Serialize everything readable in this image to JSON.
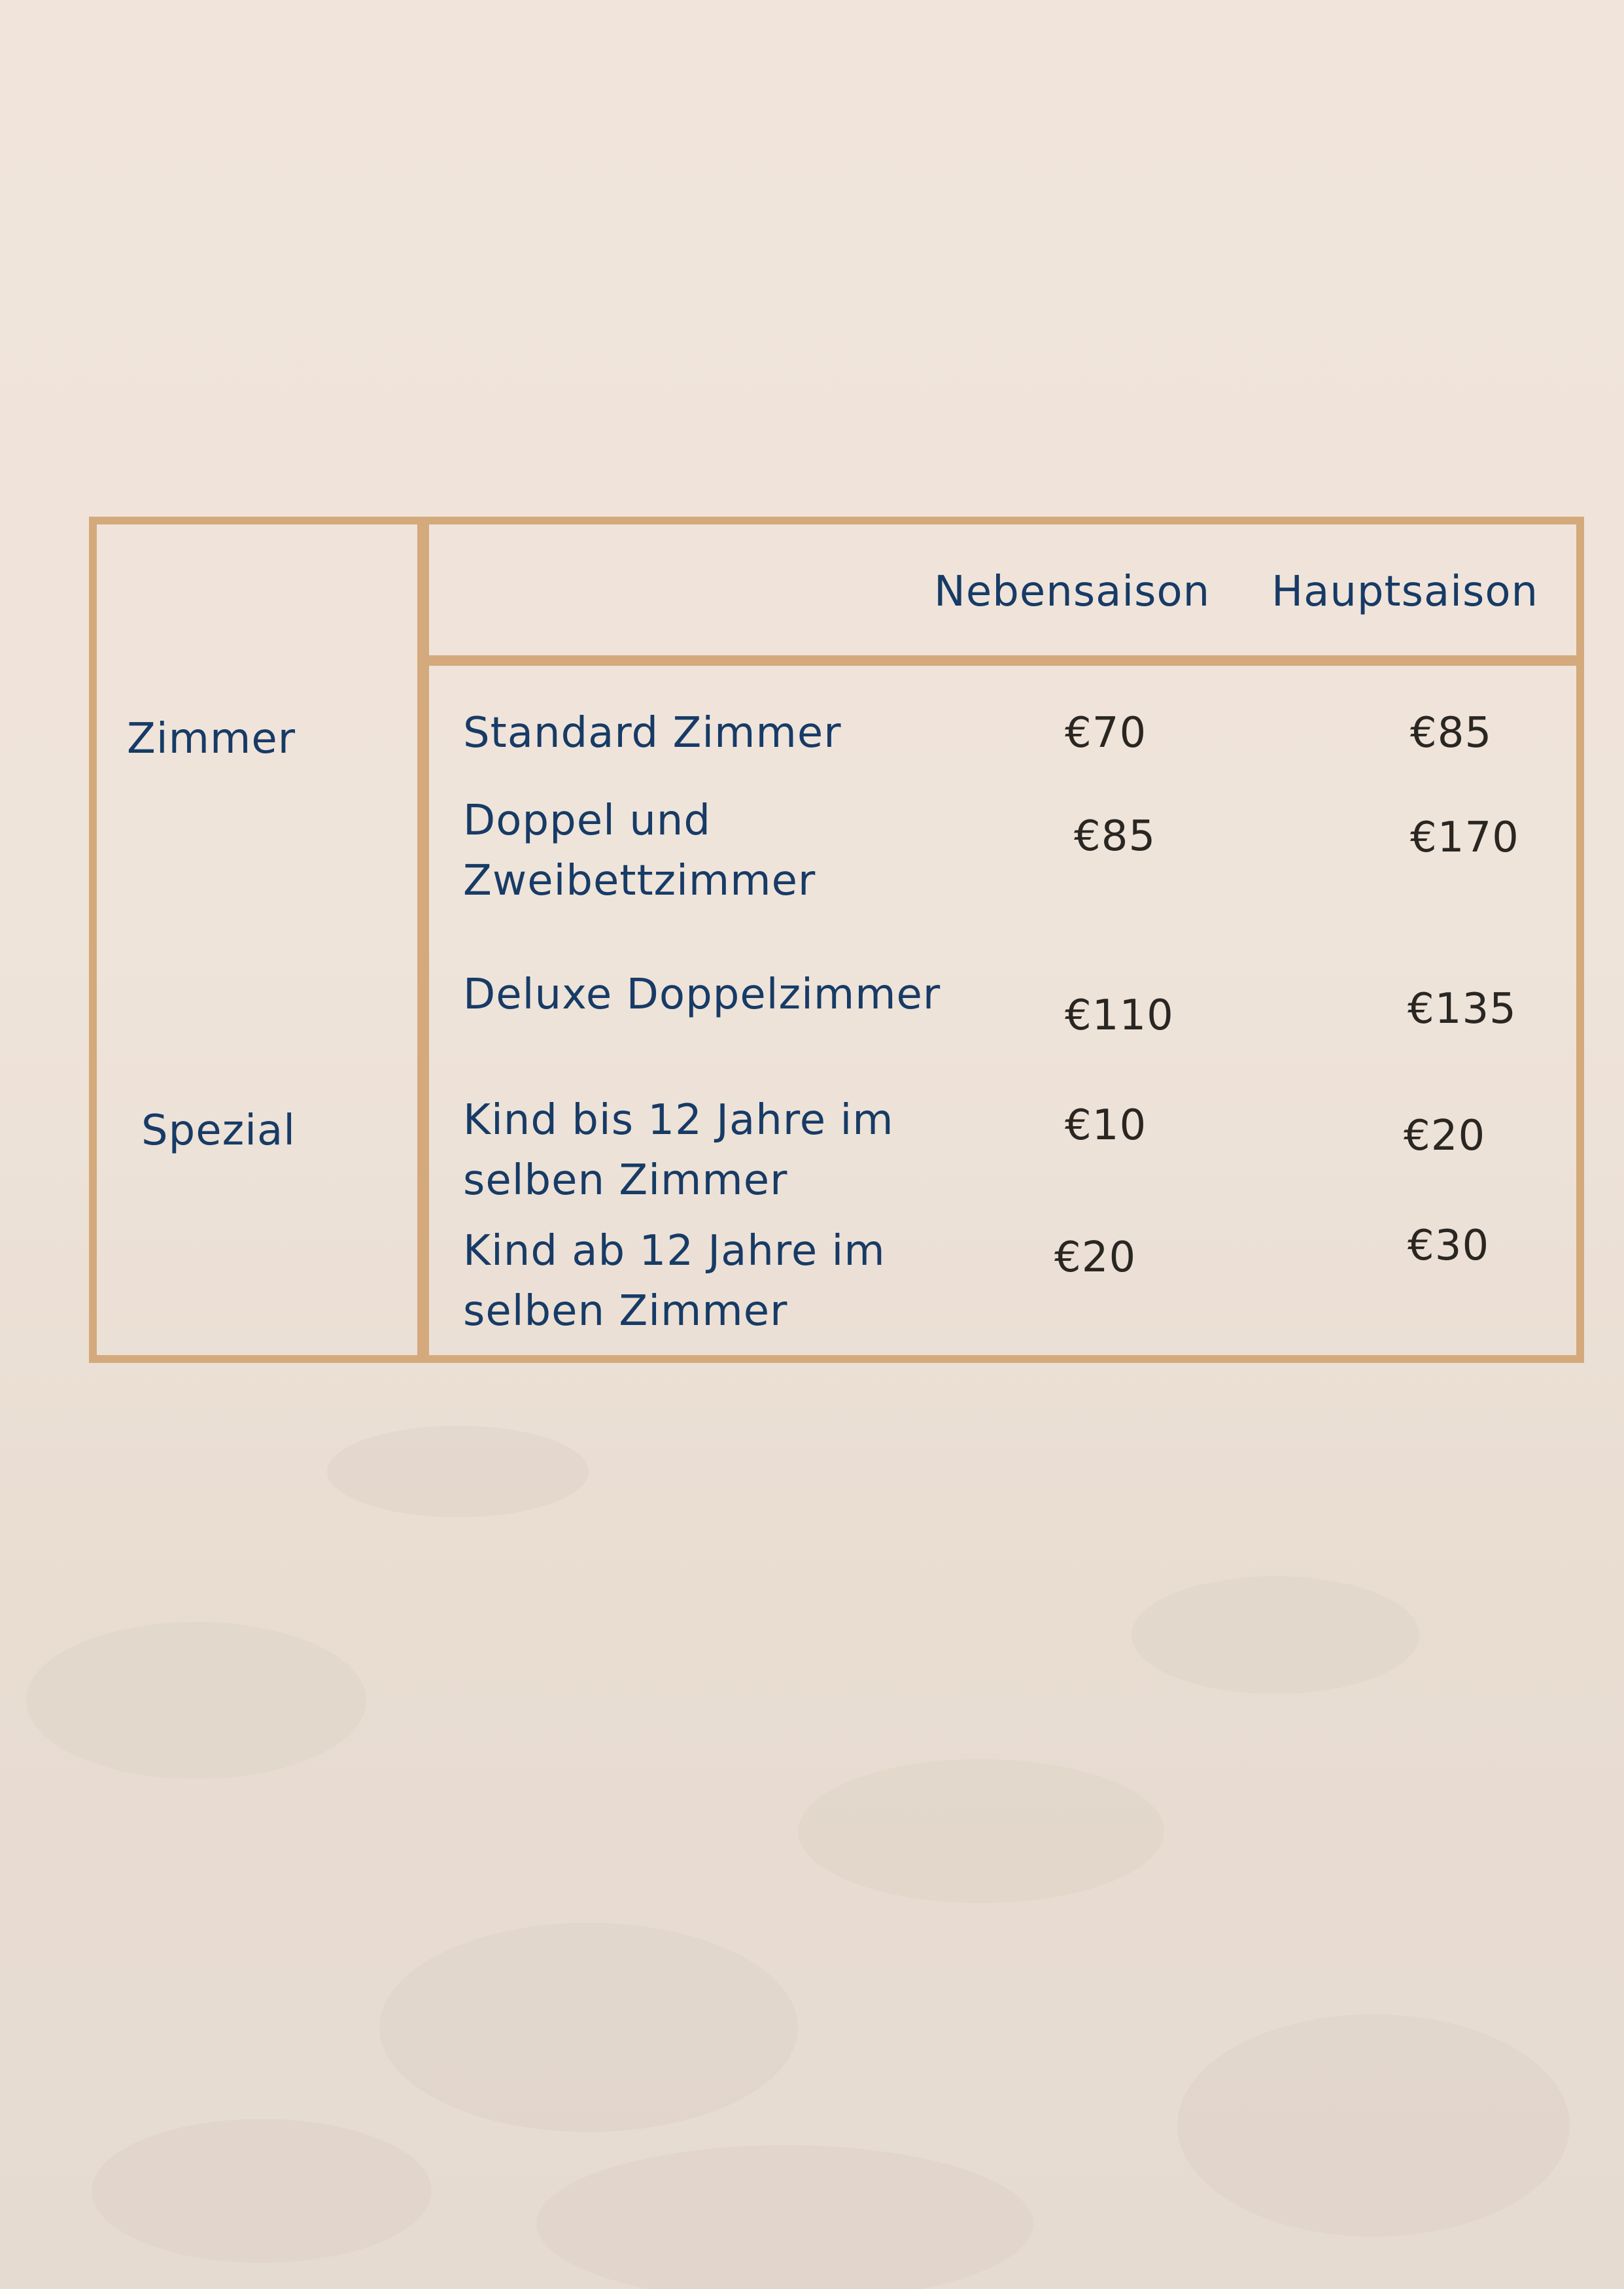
{
  "table": {
    "headers": {
      "off_season": "Nebensaison",
      "high_season": "Hauptsaison"
    },
    "categories": {
      "rooms": "Zimmer",
      "special": "Spezial"
    },
    "rows": [
      {
        "name_line1": "Standard Zimmer",
        "name_line2": "",
        "off_season": "€70",
        "high_season": "€85"
      },
      {
        "name_line1": "Doppel und",
        "name_line2": "Zweibettzimmer",
        "off_season": "€85",
        "high_season": "€170"
      },
      {
        "name_line1": "Deluxe Doppelzimmer",
        "name_line2": "",
        "off_season": "€110",
        "high_season": "€135"
      },
      {
        "name_line1": "Kind bis 12 Jahre im",
        "name_line2": "selben Zimmer",
        "off_season": "€10",
        "high_season": "€20"
      },
      {
        "name_line1": "Kind ab 12 Jahre im",
        "name_line2": "selben Zimmer",
        "off_season": "€20",
        "high_season": "€30"
      }
    ]
  },
  "colors": {
    "background": "#f0e4da",
    "border": "#d4aa7c",
    "label_text": "#173b66",
    "price_text": "#2a2622"
  }
}
